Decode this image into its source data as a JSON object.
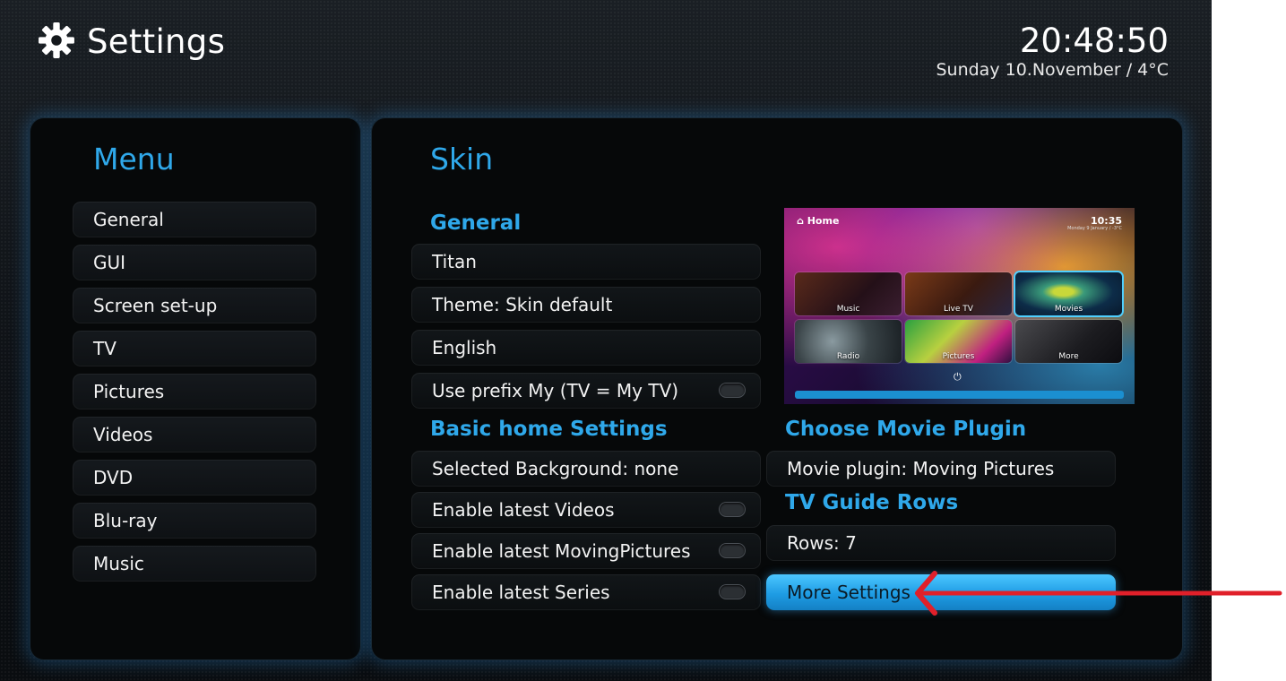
{
  "header": {
    "title": "Settings",
    "time": "20:48:50",
    "date": "Sunday 10.November / 4°C"
  },
  "menu": {
    "heading": "Menu",
    "items": [
      {
        "label": "General"
      },
      {
        "label": "GUI"
      },
      {
        "label": "Screen set-up"
      },
      {
        "label": "TV"
      },
      {
        "label": "Pictures"
      },
      {
        "label": "Videos"
      },
      {
        "label": "DVD"
      },
      {
        "label": "Blu-ray"
      },
      {
        "label": "Music"
      }
    ]
  },
  "skin": {
    "heading": "Skin",
    "general": {
      "title": "General",
      "skin": "Titan",
      "theme": "Theme: Skin default",
      "language": "English",
      "prefix": "Use prefix My (TV = My TV)",
      "prefix_enabled": false
    },
    "basic_home": {
      "title": "Basic home Settings",
      "background": "Selected Background: none",
      "latest_videos": "Enable latest Videos",
      "latest_videos_enabled": false,
      "latest_movingpictures": "Enable latest MovingPictures",
      "latest_movingpictures_enabled": false,
      "latest_series": "Enable latest Series",
      "latest_series_enabled": false
    },
    "movie_plugin": {
      "title": "Choose Movie Plugin",
      "value": "Movie plugin: Moving Pictures"
    },
    "tv_guide": {
      "title": "TV Guide Rows",
      "rows": "Rows:  7"
    },
    "more_settings": "More Settings",
    "preview": {
      "home": "Home",
      "time": "10:35",
      "date": "Monday 9 January / -3°C",
      "tiles": [
        "Music",
        "Live TV",
        "Movies",
        "Radio",
        "Pictures",
        "More"
      ]
    }
  },
  "colors": {
    "accent": "#2fa8ea",
    "button": "#1e9ce4",
    "annotation_arrow": "#e0202a"
  }
}
